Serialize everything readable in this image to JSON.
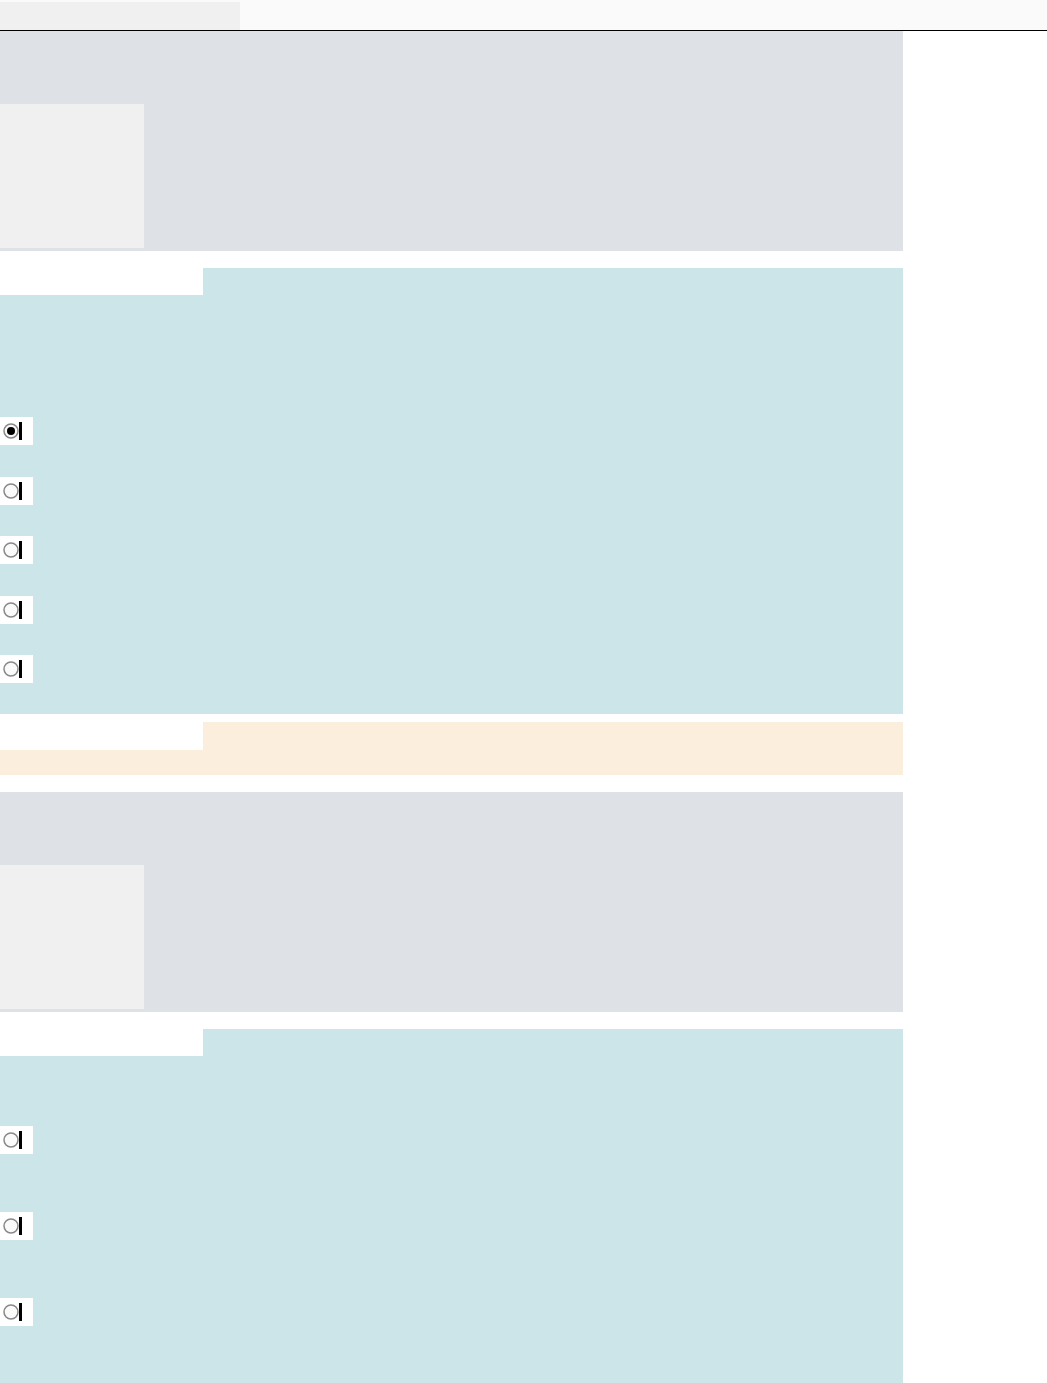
{
  "sections": [
    {
      "kind": "placeholder_panel"
    },
    {
      "kind": "choice_group",
      "options": [
        {
          "selected": true
        },
        {
          "selected": false
        },
        {
          "selected": false
        },
        {
          "selected": false
        },
        {
          "selected": false
        }
      ]
    },
    {
      "kind": "notice"
    },
    {
      "kind": "placeholder_panel"
    },
    {
      "kind": "choice_group",
      "options": [
        {
          "selected": false
        },
        {
          "selected": false
        },
        {
          "selected": false
        }
      ]
    }
  ]
}
